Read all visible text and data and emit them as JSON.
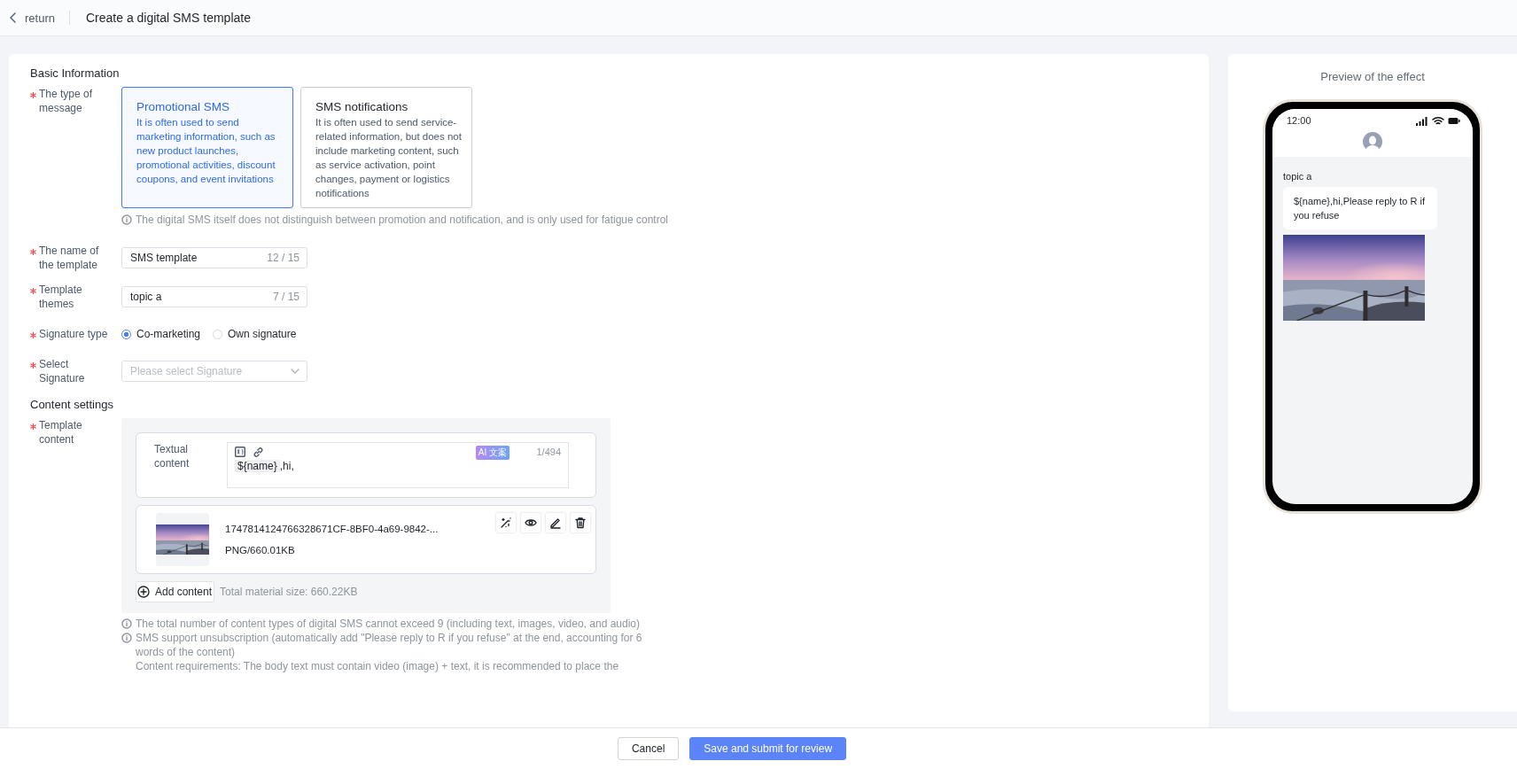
{
  "header": {
    "back_label": "return",
    "title": "Create a digital SMS template"
  },
  "basic": {
    "heading": "Basic Information",
    "message_type": {
      "label": "The type of message",
      "required": true,
      "options": [
        {
          "title": "Promotional SMS",
          "description": "It is often used to send marketing information, such as new product launches, promotional activities, discount coupons, and event invitations",
          "selected": true
        },
        {
          "title": "SMS notifications",
          "description": "It is often used to send service-related information, but does not include marketing content, such as service activation, point changes, payment or logistics notifications",
          "selected": false
        }
      ],
      "note": "The digital SMS itself does not distinguish between promotion and notification, and is only used for fatigue control"
    },
    "fields": [
      {
        "kind": "input",
        "label": "The name of the template",
        "required": true,
        "value": "SMS template",
        "counter": "12 / 15"
      },
      {
        "kind": "input",
        "label": "Template themes",
        "required": true,
        "value": "topic a",
        "counter": "7 / 15"
      },
      {
        "kind": "radio",
        "label": "Signature type",
        "required": true,
        "options": [
          {
            "label": "Co-marketing",
            "selected": true
          },
          {
            "label": "Own signature",
            "selected": false
          }
        ]
      },
      {
        "kind": "select",
        "label": "Select Signature",
        "required": true,
        "placeholder": "Please select Signature"
      }
    ]
  },
  "content": {
    "heading": "Content settings",
    "label": "Template content",
    "required": true,
    "text_block": {
      "label": "Textual content",
      "ai_badge": "AI 文案",
      "counter": "1/494",
      "variable": "${name}",
      "text": ",hi,"
    },
    "attachment": {
      "file_name": "1747814124766328671CF-8BF0-4a69-9842-...",
      "meta": "PNG/660.01KB"
    },
    "add_button": "Add content",
    "total_size": "Total material size: 660.22KB",
    "notes": [
      {
        "kind": "info",
        "text": "The total number of content types of digital SMS cannot exceed 9 (including text, images, video, and audio)"
      },
      {
        "kind": "info",
        "text": "SMS support unsubscription (automatically add \"Please reply to R if you refuse\" at the end, accounting for 6 words of the content)"
      },
      {
        "kind": "plain",
        "text": "Content requirements: The body text must contain video (image) + text, it is recommended to place the"
      }
    ]
  },
  "preview": {
    "title": "Preview of the effect",
    "time": "12:00",
    "subject": "topic a",
    "message": "${name},hi,Please reply to R if you refuse"
  },
  "footer": {
    "buttons": [
      {
        "label": "Cancel",
        "kind": "secondary"
      },
      {
        "label": "Save and submit for review",
        "kind": "primary"
      }
    ]
  }
}
